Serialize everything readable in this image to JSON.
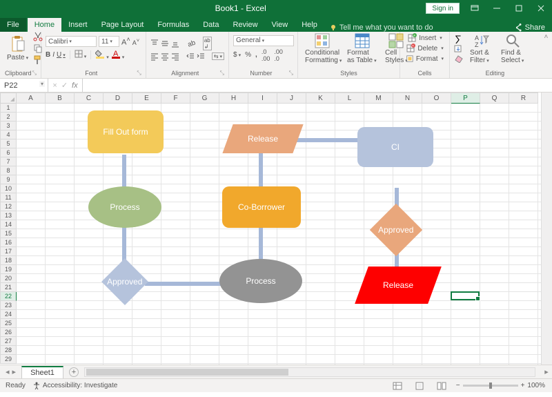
{
  "window": {
    "title_doc": "Book1",
    "title_app": "Excel",
    "sign_in": "Sign in"
  },
  "tabs": {
    "file": "File",
    "home": "Home",
    "insert": "Insert",
    "page_layout": "Page Layout",
    "formulas": "Formulas",
    "data": "Data",
    "review": "Review",
    "view": "View",
    "help": "Help",
    "tellme": "Tell me what you want to do",
    "share": "Share"
  },
  "ribbon": {
    "clipboard": "Clipboard",
    "font": "Font",
    "alignment": "Alignment",
    "number": "Number",
    "styles": "Styles",
    "cells": "Cells",
    "editing": "Editing",
    "paste": "Paste",
    "font_name": "Calibri",
    "font_size": "11",
    "number_format": "General",
    "conditional": "Conditional Formatting",
    "format_as": "Format as Table",
    "cell_styles": "Cell Styles",
    "insert": "Insert",
    "delete": "Delete",
    "format": "Format",
    "sort": "Sort & Filter",
    "find": "Find & Select"
  },
  "namebox": "P22",
  "columns": [
    "A",
    "B",
    "C",
    "D",
    "E",
    "F",
    "G",
    "H",
    "I",
    "J",
    "K",
    "L",
    "M",
    "N",
    "O",
    "P",
    "Q",
    "R"
  ],
  "row_count": 29,
  "active_col": "P",
  "active_row": 22,
  "shapes": {
    "fillout": "Fill Out form",
    "process1": "Process",
    "release1": "Release",
    "coborrower": "Co-Borrower",
    "process2": "Process",
    "approved1": "Approved",
    "ci": "CI",
    "approved2": "Approved",
    "release2": "Release"
  },
  "sheet": {
    "tab1": "Sheet1"
  },
  "status": {
    "ready": "Ready",
    "acc": "Accessibility: Investigate",
    "zoom": "100%"
  }
}
